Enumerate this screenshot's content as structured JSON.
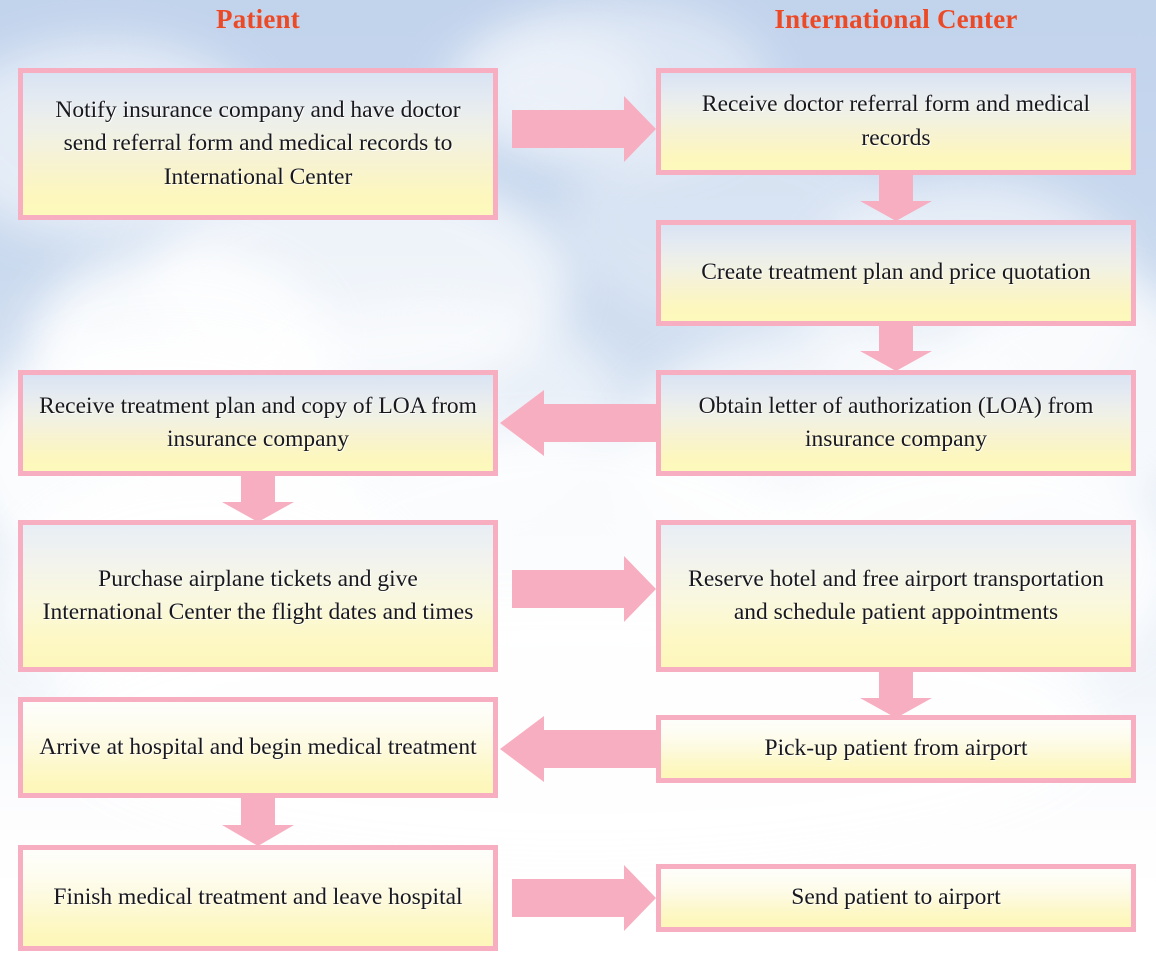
{
  "diagram": {
    "title_left": "Patient",
    "title_right": "International Center",
    "accent_color": "#ec4a26",
    "arrow_color": "#f7aec0",
    "box_border_color": "#f6aec0"
  },
  "columns": {
    "left": {
      "header": "Patient",
      "steps": [
        {
          "id": "p1",
          "text": "Notify insurance company and have doctor send referral form and medical records to International Center"
        },
        {
          "id": "p2",
          "text": "Receive treatment plan and copy of LOA from insurance company"
        },
        {
          "id": "p3",
          "text": "Purchase airplane tickets and give International Center the flight dates and times"
        },
        {
          "id": "p4",
          "text": "Arrive at hospital and begin medical treatment"
        },
        {
          "id": "p5",
          "text": "Finish medical treatment and leave hospital"
        }
      ]
    },
    "right": {
      "header": "International Center",
      "steps": [
        {
          "id": "c1",
          "text": "Receive doctor referral form and medical records"
        },
        {
          "id": "c2",
          "text": "Create treatment plan and price quotation"
        },
        {
          "id": "c3",
          "text": "Obtain letter of authorization (LOA) from insurance company"
        },
        {
          "id": "c4",
          "text": "Reserve hotel and free airport transportation and schedule patient appointments"
        },
        {
          "id": "c5",
          "text": "Pick-up patient from airport"
        },
        {
          "id": "c6",
          "text": "Send patient to airport"
        }
      ]
    }
  },
  "connectors": [
    {
      "id": "a1",
      "direction": "right",
      "from": "p1",
      "to": "c1"
    },
    {
      "id": "a2",
      "direction": "down",
      "from": "c1",
      "to": "c2"
    },
    {
      "id": "a3",
      "direction": "down",
      "from": "c2",
      "to": "c3"
    },
    {
      "id": "a4",
      "direction": "left",
      "from": "c3",
      "to": "p2"
    },
    {
      "id": "a5",
      "direction": "down",
      "from": "p2",
      "to": "p3"
    },
    {
      "id": "a6",
      "direction": "right",
      "from": "p3",
      "to": "c4"
    },
    {
      "id": "a7",
      "direction": "down",
      "from": "c4",
      "to": "c5"
    },
    {
      "id": "a8",
      "direction": "left",
      "from": "c5",
      "to": "p4"
    },
    {
      "id": "a9",
      "direction": "down",
      "from": "p4",
      "to": "p5"
    },
    {
      "id": "a10",
      "direction": "right",
      "from": "p5",
      "to": "c6"
    }
  ]
}
